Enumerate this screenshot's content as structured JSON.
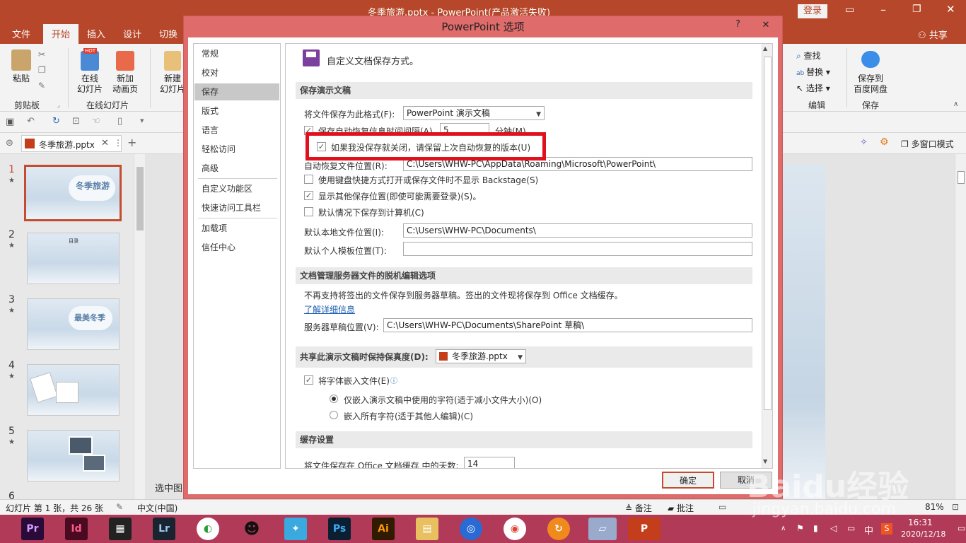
{
  "window": {
    "title": "冬季旅游.pptx - PowerPoint(产品激活失败)",
    "login": "登录",
    "share": "共享"
  },
  "ribbon_tabs": [
    "文件",
    "开始",
    "插入",
    "设计",
    "切换"
  ],
  "ribbon": {
    "paste": "粘贴",
    "clipboard_group": "剪贴板",
    "online_slides": "在线\n幻灯片",
    "new_animation": "新加\n动画页",
    "online_group": "在线幻灯片",
    "new_slide": "新建\n幻灯片",
    "hot_badge": "HOT",
    "find": "查找",
    "replace": "替换",
    "select": "选择",
    "edit_group": "编辑",
    "save_baidu": "保存到\n百度网盘",
    "save_group": "保存"
  },
  "doc_tab": {
    "name": "冬季旅游.pptx",
    "multi_window": "多窗口模式"
  },
  "thumbnails": [
    {
      "num": "1",
      "title": "冬季旅游"
    },
    {
      "num": "2",
      "title": "目录"
    },
    {
      "num": "3",
      "title": "最美冬季"
    },
    {
      "num": "4",
      "title": ""
    },
    {
      "num": "5",
      "title": ""
    },
    {
      "num": "6",
      "title": ""
    }
  ],
  "status": {
    "slide_info": "幻灯片 第 1 张，共 26 张",
    "language": "中文(中国)",
    "notes": "备注",
    "comments": "批注",
    "zoom": "81%",
    "select_area": "选中图"
  },
  "taskbar": {
    "apps": [
      "Pr",
      "Id",
      "Lr",
      "Ps",
      "Ai"
    ],
    "time": "16:31",
    "date": "2020/12/18",
    "ime": "中"
  },
  "dialog": {
    "title": "PowerPoint 选项",
    "help": "?",
    "close": "✕",
    "nav": [
      "常规",
      "校对",
      "保存",
      "版式",
      "语言",
      "轻松访问",
      "高级",
      "自定义功能区",
      "快速访问工具栏",
      "加载项",
      "信任中心"
    ],
    "header": "自定义文档保存方式。",
    "sec1": "保存演示文稿",
    "format_label": "将文件保存为此格式(F):",
    "format_value": "PowerPoint 演示文稿",
    "autosave_label": "保存自动恢复信息时间间隔(A)",
    "autosave_value": "5",
    "autosave_unit": "分钟(M)",
    "keep_last": "如果我没保存就关闭，请保留上次自动恢复的版本(U)",
    "autorecover_label": "自动恢复文件位置(R):",
    "autorecover_value": "C:\\Users\\WHW-PC\\AppData\\Roaming\\Microsoft\\PowerPoint\\",
    "no_backstage": "使用键盘快捷方式打开或保存文件时不显示 Backstage(S)",
    "show_other": "显示其他保存位置(即使可能需要登录)(S)。",
    "save_to_pc": "默认情况下保存到计算机(C)",
    "local_label": "默认本地文件位置(I):",
    "local_value": "C:\\Users\\WHW-PC\\Documents\\",
    "template_label": "默认个人模板位置(T):",
    "template_value": "",
    "sec2": "文档管理服务器文件的脱机编辑选项",
    "sec2_desc": "不再支持将签出的文件保存到服务器草稿。签出的文件现将保存到 Office 文档缓存。",
    "learn_more": "了解详细信息",
    "drafts_label": "服务器草稿位置(V):",
    "drafts_value": "C:\\Users\\WHW-PC\\Documents\\SharePoint 草稿\\",
    "sec3": "共享此演示文稿时保持保真度(D):",
    "sec3_file": "冬季旅游.pptx",
    "embed_fonts": "将字体嵌入文件(E)",
    "embed_used": "仅嵌入演示文稿中使用的字符(适于减小文件大小)(O)",
    "embed_all": "嵌入所有字符(适于其他人编辑)(C)",
    "sec4": "缓存设置",
    "cache_days_label": "将文件保存在 Office 文档缓存 中的天数:",
    "cache_days_value": "14",
    "ok": "确定",
    "cancel": "取消"
  },
  "watermark": "Baidu经验",
  "watermark_url": "jingyan.baidu.com"
}
